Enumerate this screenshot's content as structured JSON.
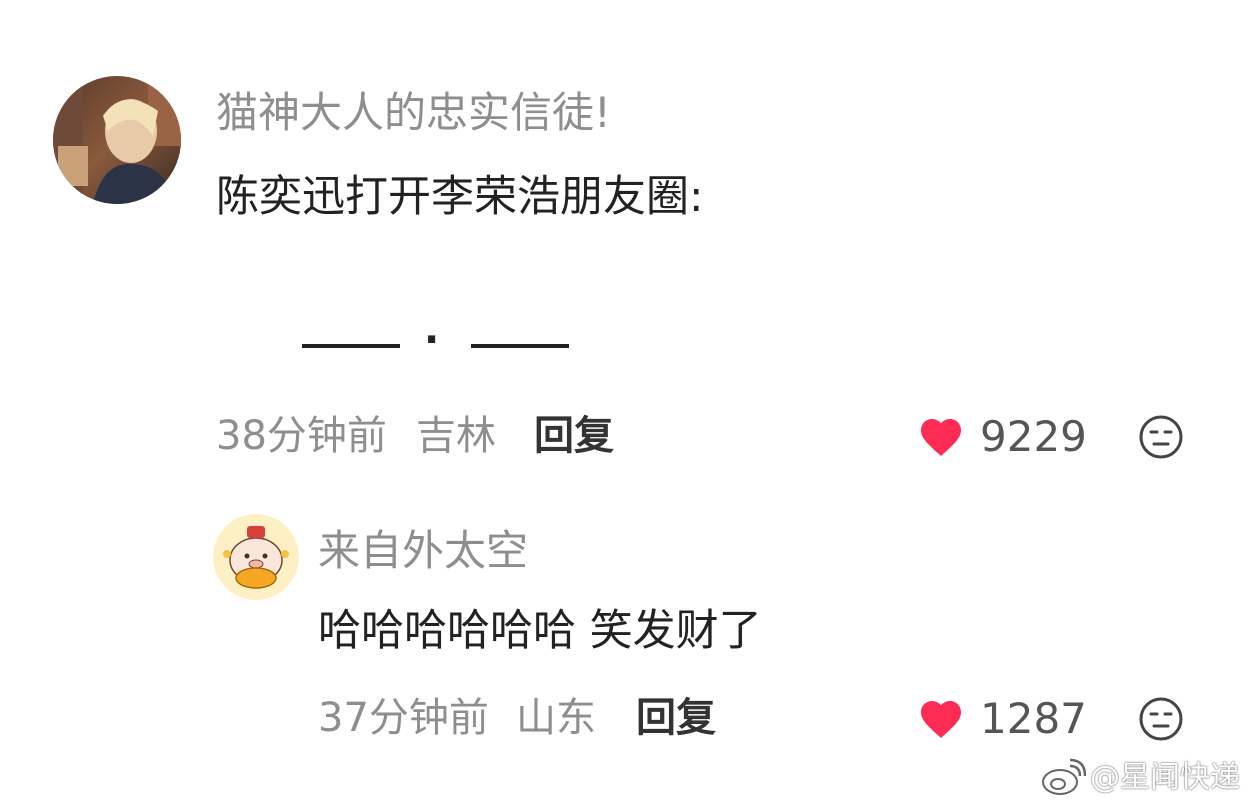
{
  "comments": [
    {
      "username": "猫神大人的忠实信徒!",
      "text": "陈奕迅打开李荣浩朋友圈:",
      "time_ago": "38分钟前",
      "location": "吉林",
      "reply_label": "回复",
      "likes": "9229"
    },
    {
      "username": "来自外太空",
      "text": "哈哈哈哈哈哈 笑发财了",
      "time_ago": "37分钟前",
      "location": "山东",
      "reply_label": "回复",
      "likes": "1287"
    }
  ],
  "face_drawing": {
    "dot": "·"
  },
  "icons": {
    "like": "heart-icon",
    "dislike": "neutral-face-icon",
    "watermark_logo": "weibo-logo-icon"
  },
  "colors": {
    "heart": "#fe2c55",
    "muted_text": "#8e8e8e"
  },
  "watermark": {
    "text": "@星闻快递"
  }
}
